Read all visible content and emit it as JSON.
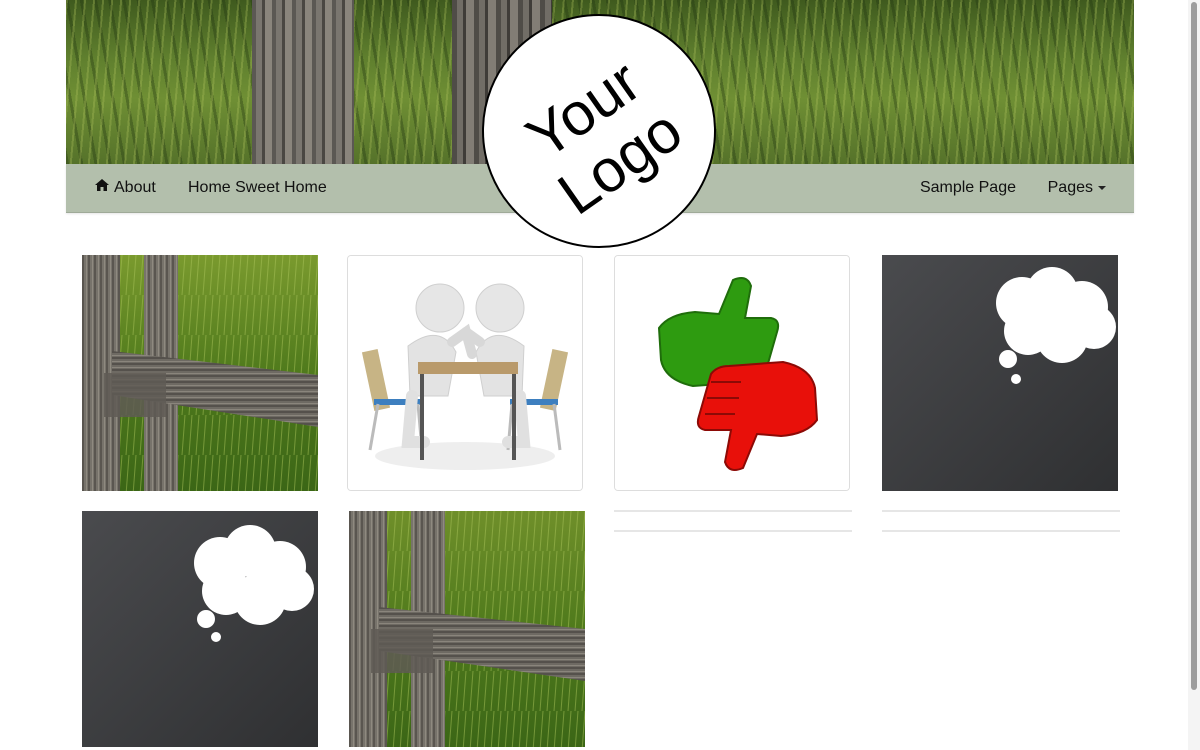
{
  "header": {
    "banner_icon": "fence-grass-photo",
    "logo": {
      "line1": "Your",
      "line2": "Logo"
    }
  },
  "nav": {
    "about": {
      "label": "About",
      "icon": "home-icon"
    },
    "home_sweet_home": {
      "label": "Home Sweet Home"
    },
    "sample_page": {
      "label": "Sample Page"
    },
    "pages": {
      "label": "Pages",
      "icon": "caret-down-icon"
    }
  },
  "gallery": {
    "items": [
      {
        "subject": "fence-grass-photo"
      },
      {
        "subject": "arm-wrestling-figures"
      },
      {
        "subject": "thumbs-up-down"
      },
      {
        "subject": "thought-bubble-slate"
      },
      {
        "subject": "thought-bubble-slate"
      },
      {
        "subject": "fence-grass-photo"
      }
    ]
  },
  "colors": {
    "navbar_bg": "#b3bfac",
    "thumb_up_green": "#2e9b10",
    "thumb_down_red": "#e8100a",
    "slate": "#3a3b3d"
  }
}
